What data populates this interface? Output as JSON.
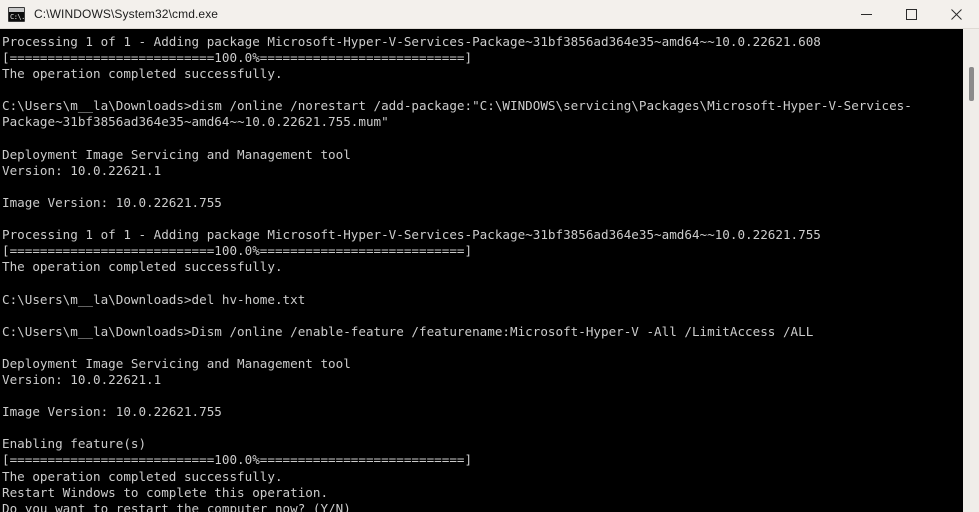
{
  "window": {
    "title": "C:\\WINDOWS\\System32\\cmd.exe",
    "icon": "cmd-icon",
    "icon_glyph": "C:\\.",
    "background": "#000000",
    "titlebar_background": "#f3f0ec",
    "text_color": "#cccccc"
  },
  "controls": {
    "minimize_label": "Minimize",
    "maximize_label": "Maximize",
    "close_label": "Close"
  },
  "scrollbar": {
    "present": true,
    "thumb_color": "#8b8b8b",
    "track_color": "#f0ede9"
  },
  "console": {
    "prompt": "C:\\Users\\m__la\\Downloads>",
    "progress_bar": "[===========================100.0%===========================]",
    "lines": [
      "Processing 1 of 1 - Adding package Microsoft-Hyper-V-Services-Package~31bf3856ad364e35~amd64~~10.0.22621.608",
      "[===========================100.0%===========================]",
      "The operation completed successfully.",
      "",
      "C:\\Users\\m__la\\Downloads>dism /online /norestart /add-package:\"C:\\WINDOWS\\servicing\\Packages\\Microsoft-Hyper-V-Services-",
      "Package~31bf3856ad364e35~amd64~~10.0.22621.755.mum\"",
      "",
      "Deployment Image Servicing and Management tool",
      "Version: 10.0.22621.1",
      "",
      "Image Version: 10.0.22621.755",
      "",
      "Processing 1 of 1 - Adding package Microsoft-Hyper-V-Services-Package~31bf3856ad364e35~amd64~~10.0.22621.755",
      "[===========================100.0%===========================]",
      "The operation completed successfully.",
      "",
      "C:\\Users\\m__la\\Downloads>del hv-home.txt",
      "",
      "C:\\Users\\m__la\\Downloads>Dism /online /enable-feature /featurename:Microsoft-Hyper-V -All /LimitAccess /ALL",
      "",
      "Deployment Image Servicing and Management tool",
      "Version: 10.0.22621.1",
      "",
      "Image Version: 10.0.22621.755",
      "",
      "Enabling feature(s)",
      "[===========================100.0%===========================]",
      "The operation completed successfully.",
      "Restart Windows to complete this operation.",
      "Do you want to restart the computer now? (Y/N)"
    ]
  }
}
